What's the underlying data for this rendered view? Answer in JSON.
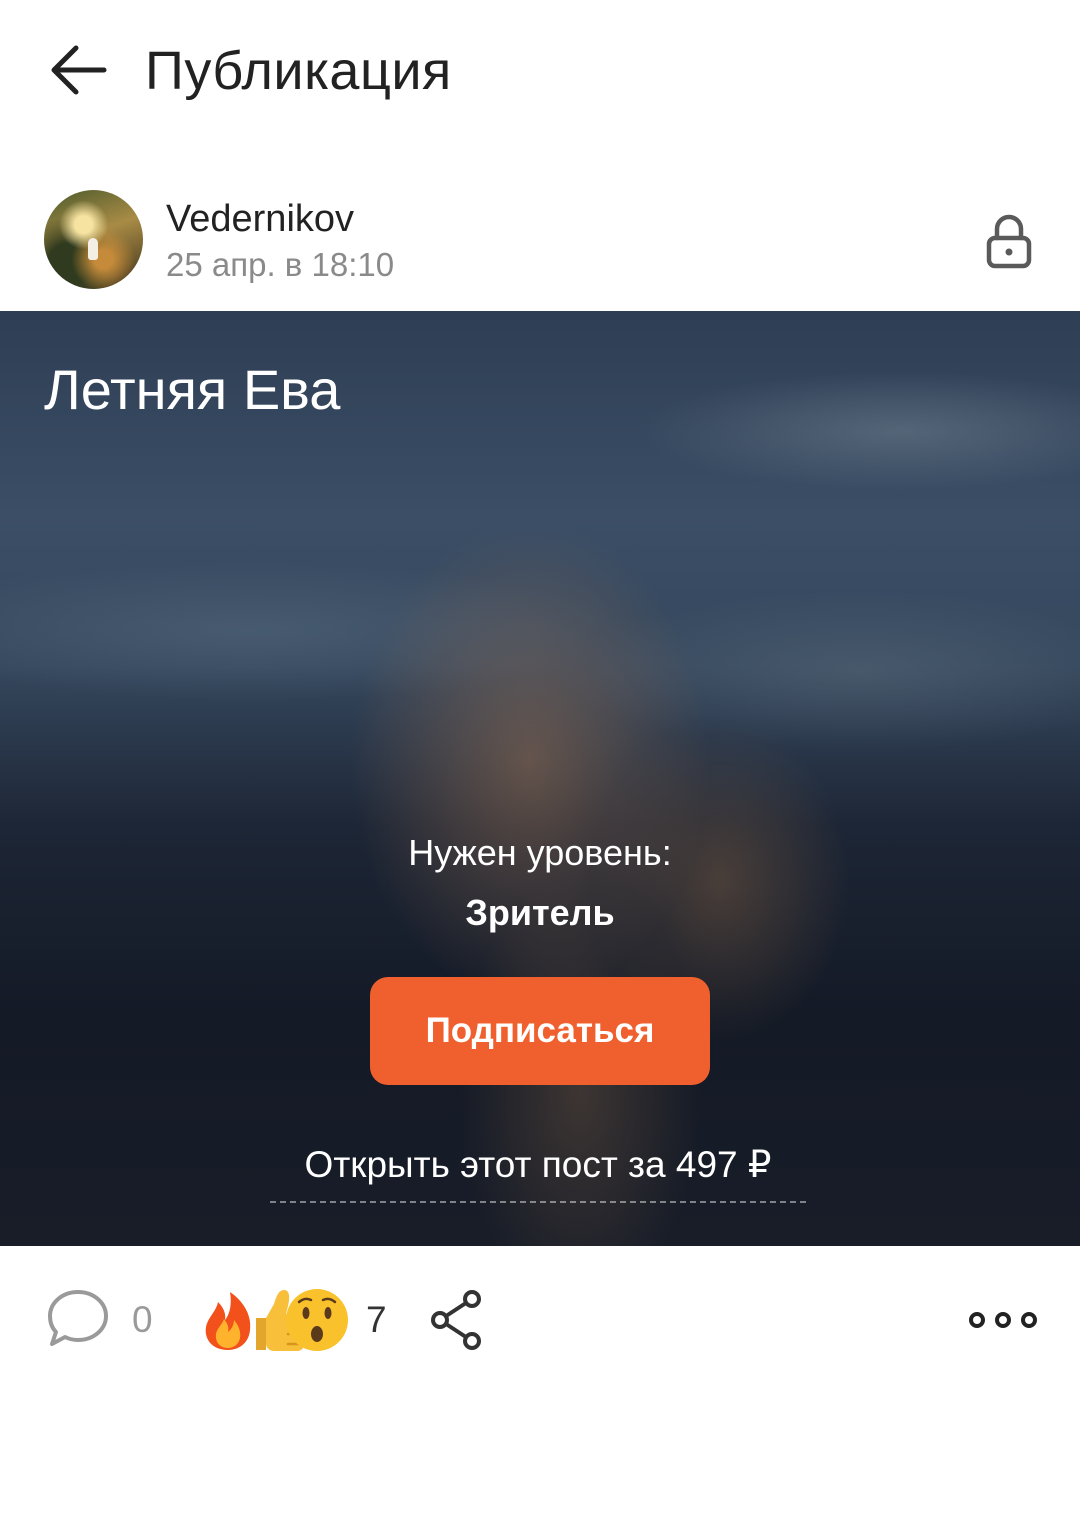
{
  "header": {
    "title": "Публикация",
    "back_icon": "arrow-left-icon"
  },
  "post": {
    "author": "Vedernikov",
    "date": "25 апр. в 18:10",
    "lock_icon": "lock-icon",
    "media": {
      "title": "Летняя Ева",
      "level_label": "Нужен уровень:",
      "level_name": "Зритель",
      "subscribe_label": "Подписаться",
      "open_label": "Открыть этот пост за 497 ₽"
    },
    "actions": {
      "comment_count": "0",
      "reaction_count": "7",
      "reactions": [
        "fire",
        "thumbs-up",
        "surprised-face"
      ]
    }
  },
  "colors": {
    "accent": "#f0602e",
    "title_text": "#222222",
    "secondary_text": "#8a8a8a"
  }
}
